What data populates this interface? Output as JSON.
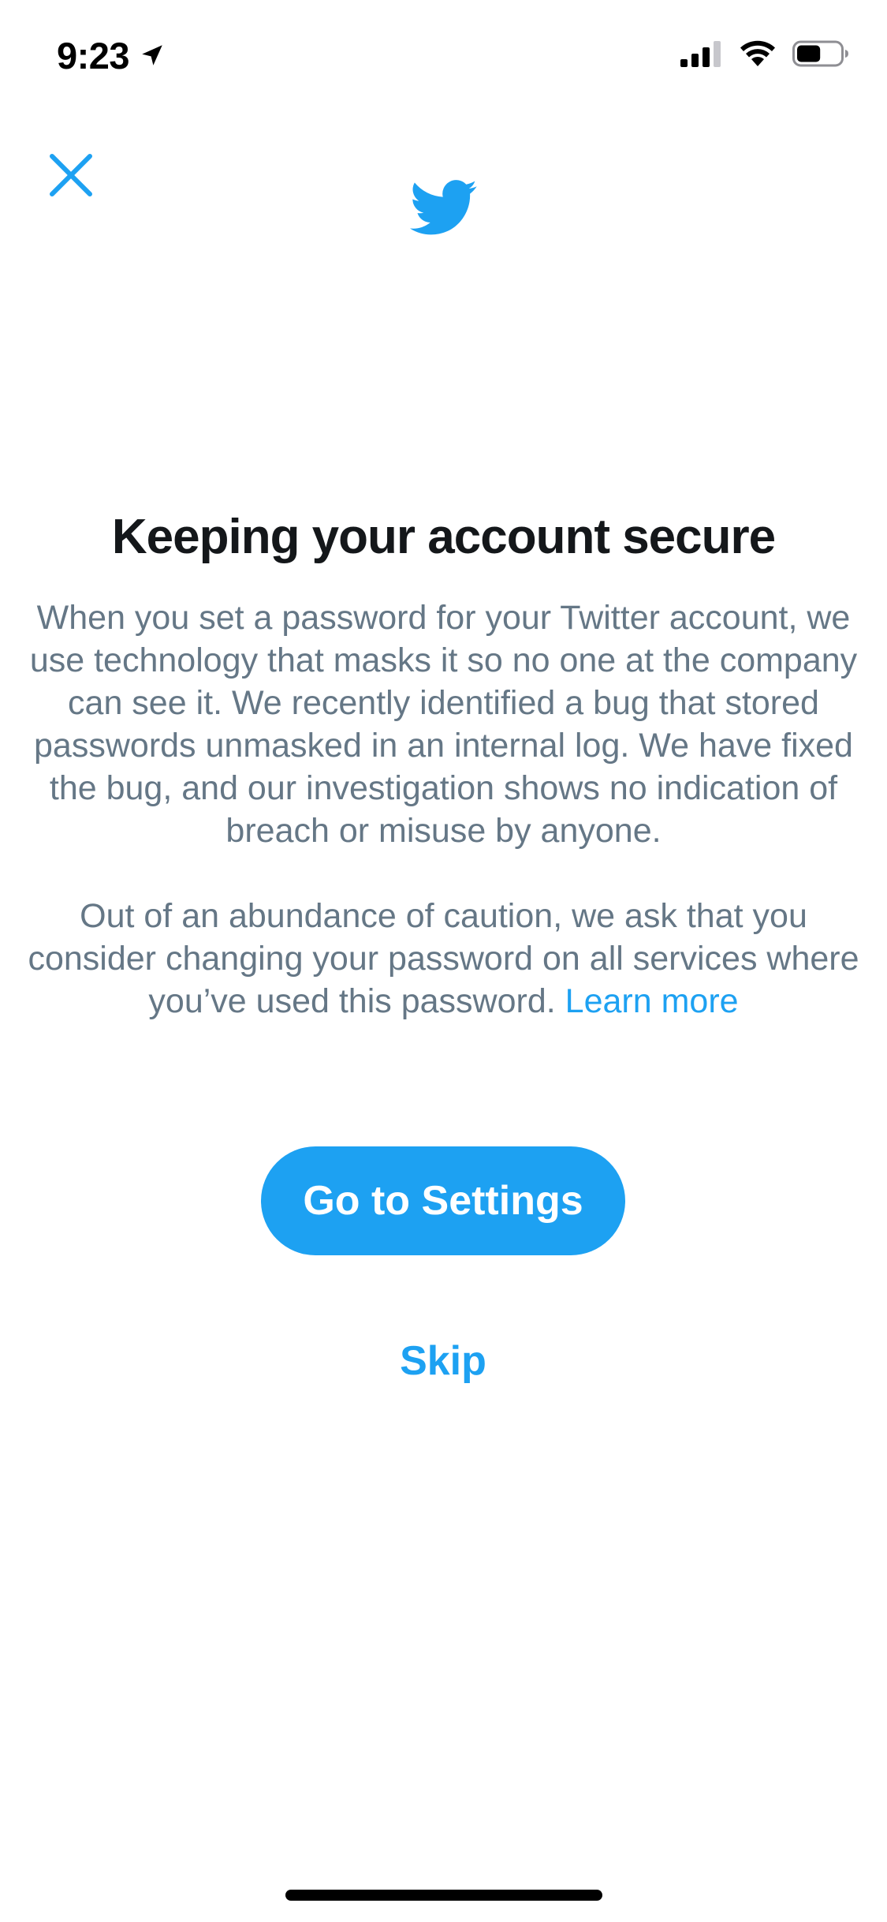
{
  "status_bar": {
    "time": "9:23",
    "location_icon": "location-arrow-icon",
    "signal_icon": "cellular-signal-icon",
    "wifi_icon": "wifi-icon",
    "battery_icon": "battery-icon",
    "battery_level": 0.55
  },
  "header": {
    "close_icon": "close-icon",
    "logo_icon": "twitter-bird-icon"
  },
  "main": {
    "title": "Keeping your account secure",
    "paragraph_1": "When you set a password for your Twitter account, we use technology that masks it so no one at the company can see it. We recently identified a bug that stored passwords unmasked in an internal log. We have fixed the bug, and our investigation shows no indication of breach or misuse by anyone.",
    "paragraph_2": "Out of an abundance of caution, we ask that you consider changing your password on all services where you’ve used this password.",
    "learn_more": "Learn more"
  },
  "actions": {
    "primary_label": "Go to Settings",
    "secondary_label": "Skip"
  },
  "colors": {
    "accent": "#1da1f2",
    "title": "#14171a",
    "body_text": "#657786",
    "background": "#ffffff"
  }
}
